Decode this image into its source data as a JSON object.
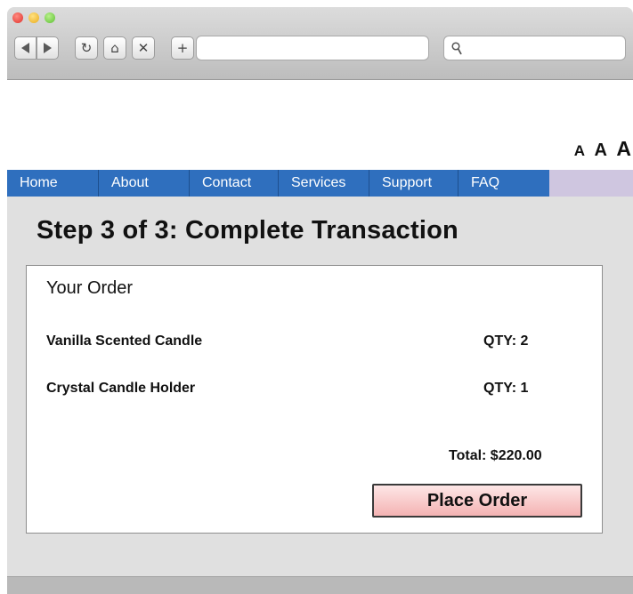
{
  "browser": {
    "toolbar": {
      "back_icon": "back-arrow",
      "forward_icon": "forward-arrow",
      "reload_glyph": "↻",
      "home_glyph": "⌂",
      "stop_glyph": "✕",
      "new_tab_glyph": "+"
    },
    "address_bar": {
      "value": ""
    },
    "search": {
      "value": ""
    }
  },
  "header": {
    "text_size": {
      "small": "A",
      "medium": "A",
      "large": "A"
    }
  },
  "nav": {
    "items": [
      {
        "label": "Home"
      },
      {
        "label": "About"
      },
      {
        "label": "Contact"
      },
      {
        "label": "Services"
      },
      {
        "label": "Support"
      },
      {
        "label": "FAQ"
      }
    ],
    "color": "#2f6fbe"
  },
  "main": {
    "title": "Step 3 of 3: Complete Transaction",
    "order": {
      "heading": "Your Order",
      "items": [
        {
          "name": "Vanilla Scented Candle",
          "qty": "QTY: 2"
        },
        {
          "name": "Crystal Candle Holder",
          "qty": "QTY: 1"
        }
      ],
      "total": "Total: $220.00",
      "place_order_label": "Place Order"
    }
  }
}
